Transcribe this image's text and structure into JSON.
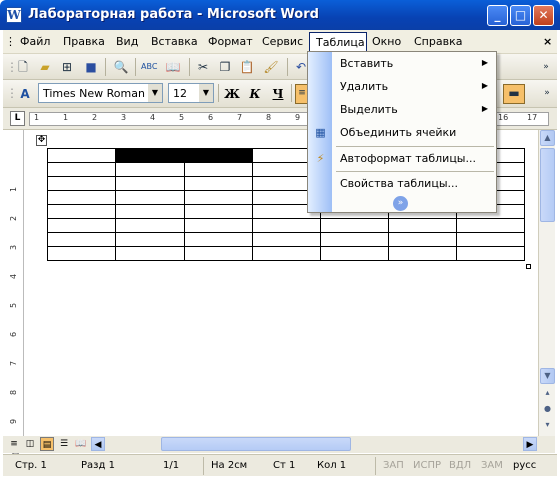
{
  "window": {
    "title": "Лабораторная работа - Microsoft Word",
    "app_icon": "W"
  },
  "menu": {
    "items": [
      "Файл",
      "Правка",
      "Вид",
      "Вставка",
      "Формат",
      "Сервис",
      "Таблица",
      "Окно",
      "Справка"
    ],
    "close_glyph": "×"
  },
  "formatting": {
    "font": "Times New Roman",
    "size": "12",
    "bold": "Ж",
    "italic": "К",
    "underline": "Ч"
  },
  "ruler": {
    "h_numbers": [
      "1",
      "1",
      "2",
      "3",
      "4",
      "5",
      "6",
      "7",
      "8",
      "9",
      "10",
      "11",
      "12",
      "13",
      "14",
      "15",
      "16",
      "17"
    ],
    "v_numbers": [
      "1",
      "2",
      "3",
      "4",
      "5",
      "6",
      "7",
      "8",
      "9",
      "10"
    ],
    "corner": "L"
  },
  "table_menu": {
    "items": [
      {
        "label": "Вставить",
        "has_submenu": true
      },
      {
        "label": "Удалить",
        "has_submenu": true
      },
      {
        "label": "Выделить",
        "has_submenu": true
      },
      {
        "label": "Объединить ячейки",
        "has_submenu": false
      },
      {
        "label": "Автоформат таблицы...",
        "has_submenu": false
      },
      {
        "label": "Свойства таблицы...",
        "has_submenu": false
      }
    ],
    "expand_glyph": "»"
  },
  "statusbar": {
    "page": "Стр.  1",
    "section": "Разд  1",
    "pages": "1/1",
    "at": "На  2см",
    "line": "Ст  1",
    "col": "Кол  1",
    "rec": "ЗАП",
    "trk": "ИСПР",
    "ext": "ВДЛ",
    "ovr": "ЗАМ",
    "lang": "русс"
  },
  "colors": {
    "title_bar": "#0842b3",
    "menu_gutter": "#9ebff6",
    "merged_cell": "#000000"
  }
}
